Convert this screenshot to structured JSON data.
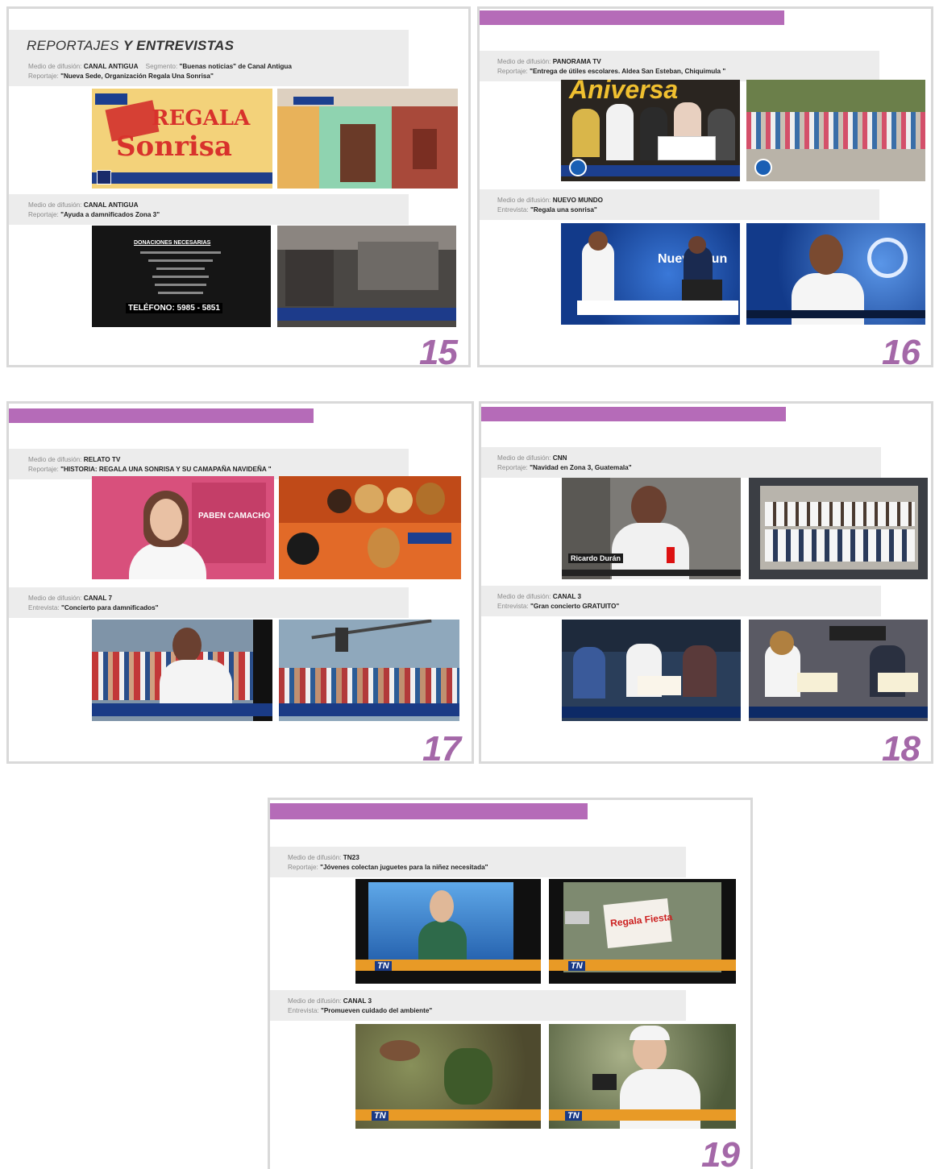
{
  "pages": [
    {
      "number": "15",
      "title": {
        "light": "REPORTAJES",
        "bold": "Y ENTREVISTAS"
      },
      "items": [
        {
          "media_label": "Medio de difusión:",
          "media": "CANAL ANTIGUA",
          "seg_label": "Segmento:",
          "segment": "\"Buenas noticias\" de Canal Antigua",
          "type_label": "Reportaje:",
          "title": "\"Nueva Sede, Organización Regala Una Sonrisa\""
        },
        {
          "media_label": "Medio de difusión:",
          "media": "CANAL ANTIGUA",
          "type_label": "Reportaje:",
          "title": "\"Ayuda a damnificados Zona 3\""
        }
      ],
      "photo_text": {
        "regala": "REGALA",
        "sonrisa": "Sonrisa",
        "donaciones": "DONACIONES NECESARIAS",
        "telefono": "TELÉFONO: 5985 - 5851"
      }
    },
    {
      "number": "16",
      "items": [
        {
          "media_label": "Medio de difusión:",
          "media": "PANORAMA TV",
          "type_label": "Reportaje:",
          "title": "\"Entrega de útiles escolares. Aldea San Esteban, Chiquimula \""
        },
        {
          "media_label": "Medio de difusión:",
          "media": "NUEVO MUNDO",
          "type_label": "Entrevista:",
          "title": "\"Regala una sonrisa\""
        }
      ],
      "photo_text": {
        "banner": "Aniversa",
        "nuevo": "Nuevo Mun"
      }
    },
    {
      "number": "17",
      "items": [
        {
          "media_label": "Medio de difusión:",
          "media": "RELATO TV",
          "type_label": "Reportaje:",
          "title": "\"HISTORIA: REGALA UNA SONRISA Y SU CAMAPAÑA NAVIDEÑA \""
        },
        {
          "media_label": "Medio de difusión:",
          "media": "CANAL 7",
          "type_label": "Entrevista:",
          "title": "\"Concierto para damnificados\""
        }
      ],
      "photo_text": {
        "sign": "PABEN CAMACHO"
      }
    },
    {
      "number": "18",
      "items": [
        {
          "media_label": "Medio de difusión:",
          "media": "CNN",
          "type_label": "Reportaje:",
          "title": "\"Navidad en Zona 3, Guatemala\""
        },
        {
          "media_label": "Medio de difusión:",
          "media": "CANAL 3",
          "type_label": "Entrevista:",
          "title": "\"Gran concierto GRATUITO\""
        }
      ],
      "photo_text": {
        "name": "Ricardo Durán"
      }
    },
    {
      "number": "19",
      "items": [
        {
          "media_label": "Medio de difusión:",
          "media": "TN23",
          "type_label": "Reportaje:",
          "title": "\"Jóvenes colectan juguetes para la niñez necesitada\""
        },
        {
          "media_label": "Medio de difusión:",
          "media": "CANAL 3",
          "type_label": "Entrevista:",
          "title": "\"Promueven cuidado del ambiente\""
        }
      ],
      "photo_text": {
        "tn": "TN",
        "sign": "Regala Fiesta"
      }
    }
  ]
}
